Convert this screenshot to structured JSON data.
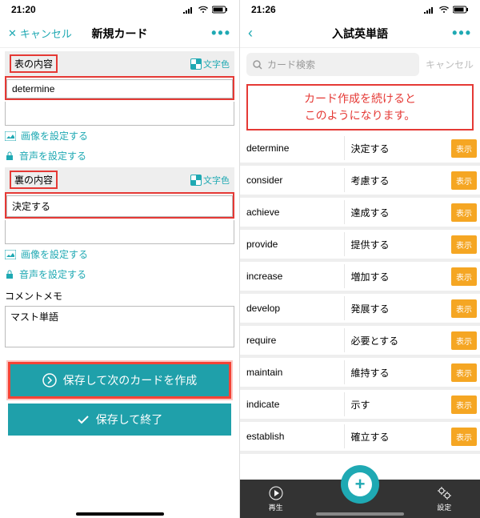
{
  "left": {
    "time": "21:20",
    "cancel": "キャンセル",
    "title": "新規カード",
    "front_label": "表の内容",
    "color_label": "文字色",
    "front_value": "determine",
    "img_link": "画像を設定する",
    "audio_link": "音声を設定する",
    "back_label": "裏の内容",
    "back_value": "決定する",
    "comment_label": "コメントメモ",
    "comment_value": "マスト単語",
    "save_next": "保存して次のカードを作成",
    "save_end": "保存して終了"
  },
  "right": {
    "time": "21:26",
    "title": "入試英単語",
    "search_placeholder": "カード検索",
    "search_cancel": "キャンセル",
    "note_l1": "カード作成を続けると",
    "note_l2": "このようになります。",
    "badge": "表示",
    "rows": [
      {
        "en": "determine",
        "ja": "決定する"
      },
      {
        "en": "consider",
        "ja": "考慮する"
      },
      {
        "en": "achieve",
        "ja": "達成する"
      },
      {
        "en": "provide",
        "ja": "提供する"
      },
      {
        "en": "increase",
        "ja": "増加する"
      },
      {
        "en": "develop",
        "ja": "発展する"
      },
      {
        "en": "require",
        "ja": "必要とする"
      },
      {
        "en": "maintain",
        "ja": "維持する"
      },
      {
        "en": "indicate",
        "ja": "示す"
      },
      {
        "en": "establish",
        "ja": "確立する"
      }
    ],
    "play": "再生",
    "settings": "設定"
  }
}
